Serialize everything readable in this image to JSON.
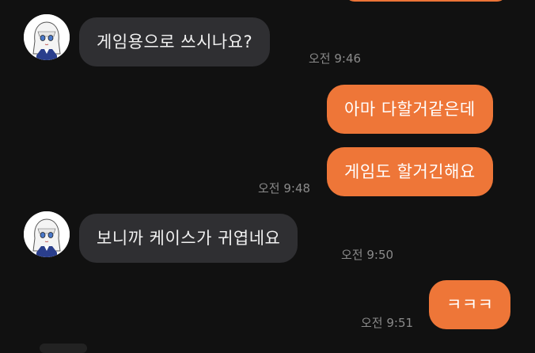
{
  "chat": {
    "messages": [
      {
        "sender": "other",
        "text": "게임용으로 쓰시나요?",
        "time": "오전 9:46"
      },
      {
        "sender": "me",
        "text": "아마 다할거같은데"
      },
      {
        "sender": "me",
        "text": "게임도 할거긴해요",
        "time": "오전 9:48"
      },
      {
        "sender": "other",
        "text": "보니까 케이스가 귀엽네요",
        "time": "오전 9:50"
      },
      {
        "sender": "me",
        "text": "ㅋㅋㅋ",
        "time": "오전 9:51"
      }
    ]
  },
  "colors": {
    "background": "#111111",
    "incoming_bubble": "#2f2f32",
    "outgoing_bubble": "#ee7638",
    "timestamp": "#8a8a8a"
  },
  "icons": {
    "avatar": "profile-avatar-icon"
  }
}
